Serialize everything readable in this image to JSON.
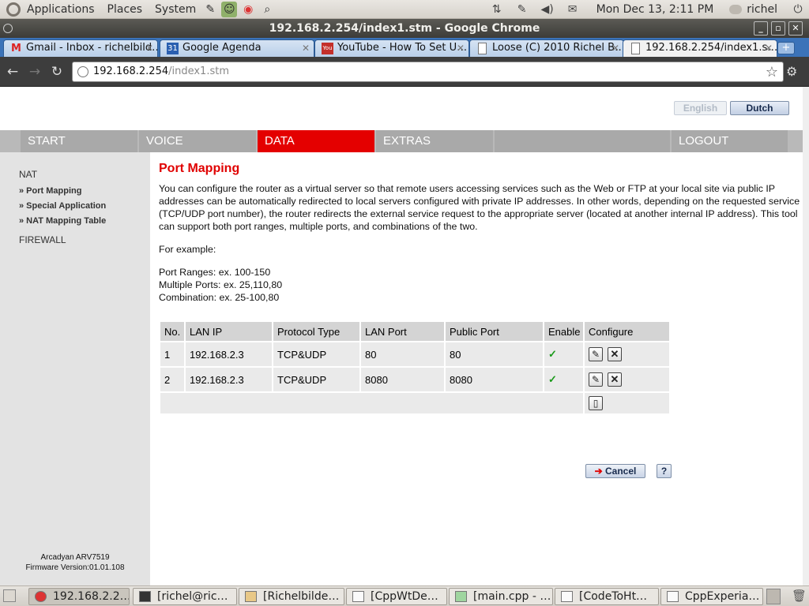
{
  "panel": {
    "menus": [
      "Applications",
      "Places",
      "System"
    ],
    "clock": "Mon Dec 13,  2:11 PM",
    "user": "richel"
  },
  "window": {
    "title": "192.168.2.254/index1.stm - Google Chrome"
  },
  "tabs": [
    {
      "label": "Gmail - Inbox - richelbild…",
      "icon": "gmail-icon"
    },
    {
      "label": "Google Agenda",
      "icon": "calendar-icon",
      "badge": "31"
    },
    {
      "label": "YouTube - How To Set U…",
      "icon": "youtube-icon",
      "badge": "You"
    },
    {
      "label": "Loose (C) 2010 Richel B…",
      "icon": "document-icon"
    },
    {
      "label": "192.168.2.254/index1.s…",
      "icon": "document-icon"
    }
  ],
  "address": {
    "host": "192.168.2.254",
    "path": "/index1.stm"
  },
  "router": {
    "lang": {
      "english": "English",
      "dutch": "Dutch"
    },
    "nav": [
      "START",
      "VOICE",
      "DATA",
      "EXTRAS",
      "",
      "LOGOUT"
    ],
    "active_nav": "DATA",
    "side": {
      "nat": "NAT",
      "items": [
        "» Port Mapping",
        "» Special Application",
        "» NAT Mapping Table"
      ],
      "firewall": "FIREWALL",
      "model": "Arcadyan ARV7519",
      "firmware": "Firmware Version:01.01.108"
    },
    "title": "Port Mapping",
    "description": "You can configure the router as a virtual server so that remote users accessing services such as the Web or FTP at your local site via public IP addresses can be automatically redirected to local servers configured with private IP addresses. In other words, depending on the requested service (TCP/UDP port number), the router redirects the external service request to the appropriate server (located at another internal IP address). This tool can support both port ranges, multiple ports, and combinations of the two.",
    "example_label": "For example:",
    "examples": [
      "Port Ranges: ex. 100-150",
      "Multiple Ports: ex. 25,110,80",
      "Combination: ex. 25-100,80"
    ],
    "table": {
      "headers": [
        "No.",
        "LAN IP",
        "Protocol Type",
        "LAN Port",
        "Public Port",
        "Enable",
        "Configure"
      ],
      "rows": [
        [
          "1",
          "192.168.2.3",
          "TCP&UDP",
          "80",
          "80"
        ],
        [
          "2",
          "192.168.2.3",
          "TCP&UDP",
          "8080",
          "8080"
        ]
      ],
      "enabled_mark": "✓"
    },
    "cancel": "Cancel",
    "help": "?"
  },
  "taskbar": [
    {
      "label": "192.168.2.2…"
    },
    {
      "label": "[richel@ric…"
    },
    {
      "label": "[Richelbilde…"
    },
    {
      "label": "[CppWtDe…"
    },
    {
      "label": "[main.cpp - …"
    },
    {
      "label": "[CodeToHt…"
    },
    {
      "label": "CppExperia…"
    }
  ]
}
